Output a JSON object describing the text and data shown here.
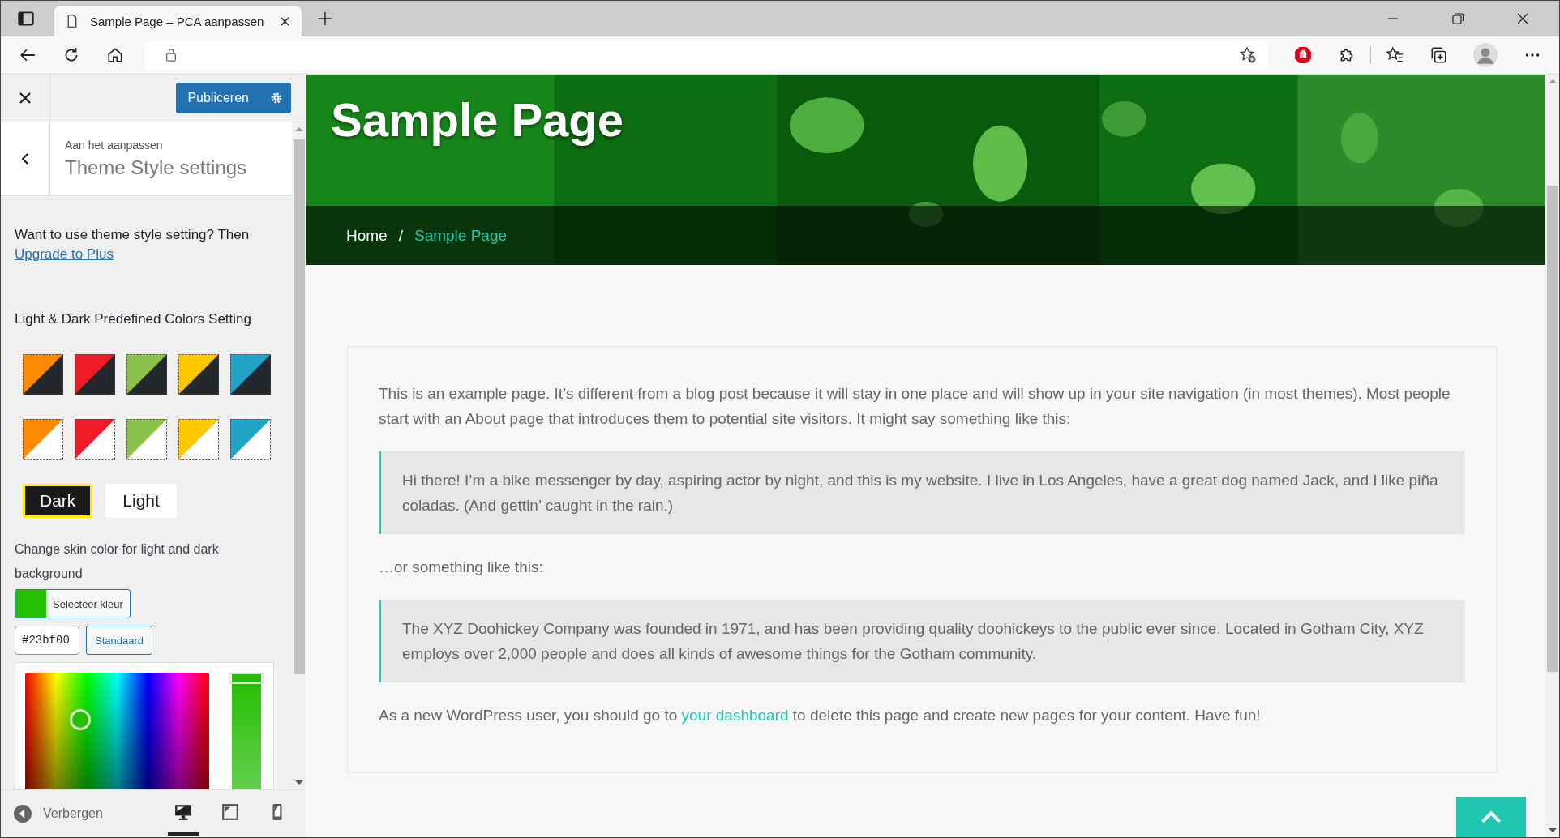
{
  "browser": {
    "tab_title": "Sample Page – PCA aanpassen"
  },
  "customizer": {
    "publish_button": "Publiceren",
    "breadcrumb": "Aan het aanpassen",
    "section_title": "Theme Style settings",
    "upsell_text": "Want to use theme style setting? Then",
    "upsell_link": "Upgrade to Plus",
    "presets_heading": "Light & Dark Predefined Colors Setting",
    "swatches": [
      {
        "color": "#ff8c00",
        "kind": "dark"
      },
      {
        "color": "#ee1c25",
        "kind": "dark"
      },
      {
        "color": "#8bc34a",
        "kind": "dark"
      },
      {
        "color": "#ffc800",
        "kind": "dark"
      },
      {
        "color": "#22a3c8",
        "kind": "dark"
      },
      {
        "color": "#ff8c00",
        "kind": "light"
      },
      {
        "color": "#ee1c25",
        "kind": "light"
      },
      {
        "color": "#8bc34a",
        "kind": "light"
      },
      {
        "color": "#ffc800",
        "kind": "light"
      },
      {
        "color": "#22a3c8",
        "kind": "light"
      }
    ],
    "modes": [
      {
        "label": "Dark",
        "kind": "dark",
        "selected": true
      },
      {
        "label": "Light",
        "kind": "light",
        "selected": false
      }
    ],
    "skin_label": "Change skin color for light and dark background",
    "select_color_button": "Selecteer kleur",
    "hex_value": "#23bf00",
    "default_button": "Standaard",
    "shade_slider": {
      "level": 1
    },
    "hide_button": "Verbergen",
    "devices": [
      {
        "kind": "desktop",
        "selected": true
      },
      {
        "kind": "tablet",
        "selected": false
      },
      {
        "kind": "mobile",
        "selected": false
      }
    ]
  },
  "preview": {
    "page_title": "Sample Page",
    "breadcrumbs": [
      {
        "label": "Home",
        "current": false
      },
      {
        "label": "Sample Page",
        "current": true
      }
    ],
    "separator": "/",
    "blocks": [
      {
        "kind": "paragraph",
        "text": "This is an example page. It’s different from a blog post because it will stay in one place and will show up in your site navigation (in most themes). Most people start with an About page that introduces them to potential site visitors. It might say something like this:"
      },
      {
        "kind": "quote",
        "text": "Hi there! I’m a bike messenger by day, aspiring actor by night, and this is my website. I live in Los Angeles, have a great dog named Jack, and I like piña coladas. (And gettin’ caught in the rain.)"
      },
      {
        "kind": "paragraph",
        "text": "…or something like this:"
      },
      {
        "kind": "quote",
        "text": "The XYZ Doohickey Company was founded in 1971, and has been providing quality doohickeys to the public ever since. Located in Gotham City, XYZ employs over 2,000 people and does all kinds of awesome things for the Gotham community."
      },
      {
        "kind": "link_paragraph",
        "before": "As a new WordPress user, you should go to",
        "link": "your dashboard",
        "after": "to delete this page and create new pages for your content. Have fun!"
      }
    ]
  }
}
